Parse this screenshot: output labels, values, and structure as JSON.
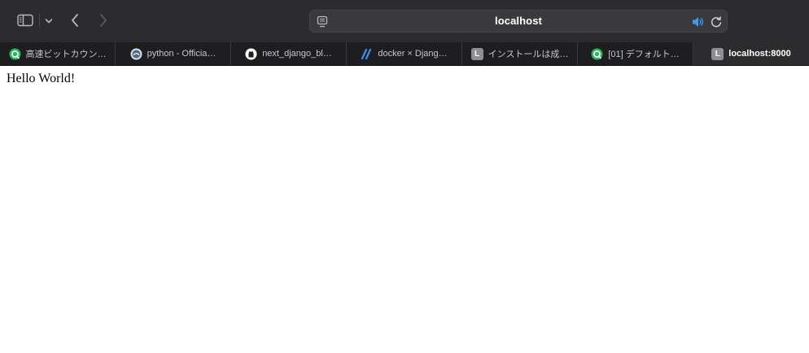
{
  "address_bar": {
    "url": "localhost"
  },
  "icons": {
    "sidebar": "sidebar-icon",
    "tab_overview_chevron": "chevron-down-icon",
    "back": "chevron-left-icon",
    "forward": "chevron-right-icon",
    "page": "page-settings-icon",
    "audio": "speaker-icon",
    "reload": "reload-icon"
  },
  "colors": {
    "toolbar": "#2c2c2e",
    "tabbar": "#1e1e20",
    "accent_audio": "#3d9cf0"
  },
  "tabs": [
    {
      "title": "高速ビットカウン…",
      "icon": "green-chat-icon"
    },
    {
      "title": "python - Officia…",
      "icon": "docker-hub-icon"
    },
    {
      "title": "next_django_bl…",
      "icon": "github-icon"
    },
    {
      "title": "docker × Djang…",
      "icon": "slash-logo-icon"
    },
    {
      "title": "インストールは成…",
      "icon": "letter-l-icon",
      "letter": "L"
    },
    {
      "title": "[01] デフォルト…",
      "icon": "green-chat-icon"
    },
    {
      "title": "localhost:8000",
      "icon": "letter-l-icon",
      "letter": "L",
      "active": true
    }
  ],
  "page": {
    "body_text": "Hello World!"
  }
}
